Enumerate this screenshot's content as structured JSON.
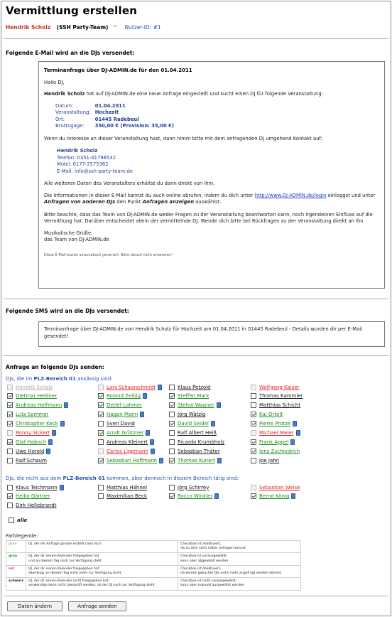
{
  "page": {
    "title": "Vermittlung erstellen",
    "user_name": "Hendrik Scholz",
    "team": "(SSH Party-Team)",
    "caret": "^",
    "user_id": "Nutzer-ID: #1"
  },
  "email": {
    "section_label": "Folgende E-Mail wird an die DJs versendet:",
    "subject": "Terminanfrage über DJ-ADMIN.de für den 01.04.2011",
    "greeting": "Hallo DJ,",
    "intro_name": "Hendrik Scholz",
    "intro_rest": " hat auf DJ-ADMIN.de eine neue Anfrage eingestellt und sucht einen DJ für folgende Veranstaltung:",
    "event": [
      {
        "label": "Datum:",
        "value": "01.04.2011"
      },
      {
        "label": "Veranstaltung:",
        "value": "Hochzeit"
      },
      {
        "label": "Ort:",
        "value": "01445 Radebeul"
      },
      {
        "label": "Bruttogage:",
        "value": "350,00 €   (Provision: 35,00 €)"
      }
    ],
    "interest": "Wenn du Interesse an dieser Veranstaltung hast, dann nimm bitte mit dem anfragenden DJ umgehend Kontakt auf:",
    "contact_name": "Hendrik Scholz",
    "contact_phone": "Telefon:   0351-41798532",
    "contact_mobile": "Mobil:      0177-2575362",
    "contact_email": "E-Mail:     info@ssh-party-team.de",
    "more_data": "Alle weiteren Daten des Veranstalters erhältst du dann direkt von ihm.",
    "online_1": "Die Informationen in dieser E-Mail kannst du auch online abrufen, indem du dich unter ",
    "online_link": "http://www.DJ-ADMIN.de/login",
    "online_2": " einloggst und unter ",
    "online_em1": "Anfragen von anderen DJs",
    "online_3": " den Punkt ",
    "online_em2": "Anfragen anzeigen",
    "online_4": " auswählst.",
    "notice": "Bitte beachte, dass das Team von DJ-ADMIN.de weder Fragen zu der Veranstaltung beantworten kann, noch irgendeinen Einfluss auf die Vermittlung hat. Darüber entscheidet allein der vermittelnde DJ. Wende dich bitte bei Rückfragen zu der Veranstaltung direkt an ihn.",
    "signoff_1": "Musikalische Grüße,",
    "signoff_2": "das Team von DJ-ADMIN.de",
    "footer": "Diese E-Mail wurde automatisch generiert. Bitte darauf nicht antworten!"
  },
  "sms": {
    "section_label": "Folgende SMS wird an die DJs versendet:",
    "text": "Terminanfrage über DJ-ADMIN.de von Hendrik Scholz für Hochzeit am 01.04.2011 in 01445 Radebeul - Details wurden dir per E-Mail gesendet!"
  },
  "request": {
    "section_label": "Anfrage an folgende DJs senden:",
    "group1_pre": "DJs, die im ",
    "group1_bold": "PLZ-Bereich 01",
    "group1_post": " ansässig sind:",
    "group2_pre": "DJs, die nicht aus dem ",
    "group2_bold": "PLZ-Bereich 01",
    "group2_post": " kommen, aber dennoch in diesem Bereich tätig sind:",
    "group1": [
      {
        "name": "Hendrik Scholz",
        "color": "grey",
        "checked": false,
        "disabled": true,
        "icon": false
      },
      {
        "name": "Lars Schaarschmidt",
        "color": "red",
        "checked": false,
        "disabled": true,
        "icon": true
      },
      {
        "name": "Klaus Petzold",
        "color": "black",
        "checked": false,
        "disabled": false,
        "icon": false
      },
      {
        "name": "Wolfgang Kaiser",
        "color": "red",
        "checked": false,
        "disabled": true,
        "icon": false
      },
      {
        "name": "Dietmar Heldner",
        "color": "green",
        "checked": true,
        "disabled": false,
        "icon": false
      },
      {
        "name": "Roland Zeibig",
        "color": "green",
        "checked": true,
        "disabled": false,
        "icon": true
      },
      {
        "name": "Steffen Marx",
        "color": "green",
        "checked": true,
        "disabled": false,
        "icon": false
      },
      {
        "name": "Thomas Kammler",
        "color": "black",
        "checked": false,
        "disabled": false,
        "icon": false
      },
      {
        "name": "Andreas Hoffmann",
        "color": "green",
        "checked": true,
        "disabled": false,
        "icon": true
      },
      {
        "name": "Detlef Lahmer",
        "color": "green",
        "checked": true,
        "disabled": false,
        "icon": false
      },
      {
        "name": "Stefan Wagner",
        "color": "green",
        "checked": true,
        "disabled": false,
        "icon": true
      },
      {
        "name": "Matthias Schicht",
        "color": "black",
        "checked": false,
        "disabled": false,
        "icon": false
      },
      {
        "name": "Lutz Sommer",
        "color": "green",
        "checked": true,
        "disabled": false,
        "icon": false
      },
      {
        "name": "Hagen Mann",
        "color": "green",
        "checked": true,
        "disabled": false,
        "icon": true
      },
      {
        "name": "Jörg Wätzig",
        "color": "black",
        "checked": false,
        "disabled": false,
        "icon": false
      },
      {
        "name": "Kai Ortelt",
        "color": "green",
        "checked": true,
        "disabled": false,
        "icon": false
      },
      {
        "name": "Christopher Keck",
        "color": "green",
        "checked": true,
        "disabled": false,
        "icon": true
      },
      {
        "name": "Sven David",
        "color": "black",
        "checked": false,
        "disabled": false,
        "icon": false
      },
      {
        "name": "David Seidel",
        "color": "green",
        "checked": true,
        "disabled": false,
        "icon": true
      },
      {
        "name": "Pierre Protze",
        "color": "green",
        "checked": true,
        "disabled": false,
        "icon": true
      },
      {
        "name": "Ronny Sickert",
        "color": "red",
        "checked": false,
        "disabled": true,
        "icon": true
      },
      {
        "name": "Arndt Grützner",
        "color": "green",
        "checked": true,
        "disabled": false,
        "icon": true
      },
      {
        "name": "Ralf Albert Heiß",
        "color": "black",
        "checked": false,
        "disabled": false,
        "icon": false
      },
      {
        "name": "Michael Meier",
        "color": "red",
        "checked": false,
        "disabled": true,
        "icon": true
      },
      {
        "name": "Olaf Habnch",
        "color": "green",
        "checked": true,
        "disabled": false,
        "icon": true
      },
      {
        "name": "Andreas Kleinert",
        "color": "black",
        "checked": false,
        "disabled": false,
        "icon": true
      },
      {
        "name": "Ricardo Krumbholz",
        "color": "black",
        "checked": false,
        "disabled": false,
        "icon": false
      },
      {
        "name": "Frank Appel",
        "color": "green",
        "checked": true,
        "disabled": false,
        "icon": true
      },
      {
        "name": "Uwe Horold",
        "color": "black",
        "checked": false,
        "disabled": false,
        "icon": true
      },
      {
        "name": "Carlos Lippmann",
        "color": "red",
        "checked": false,
        "disabled": true,
        "icon": true
      },
      {
        "name": "Sebastian Thäter",
        "color": "black",
        "checked": false,
        "disabled": false,
        "icon": false
      },
      {
        "name": "Jens Zschiedrich",
        "color": "green",
        "checked": true,
        "disabled": false,
        "icon": false
      },
      {
        "name": "Ralf Schaum",
        "color": "black",
        "checked": false,
        "disabled": false,
        "icon": false
      },
      {
        "name": "Sebastian Hoffmann",
        "color": "green",
        "checked": true,
        "disabled": false,
        "icon": true
      },
      {
        "name": "Thomas Kunert",
        "color": "green",
        "checked": true,
        "disabled": false,
        "icon": true
      },
      {
        "name": "Joe Jahn",
        "color": "black",
        "checked": false,
        "disabled": false,
        "icon": false
      }
    ],
    "group2": [
      {
        "name": "Klaus Teichmann",
        "color": "black",
        "checked": false,
        "disabled": false,
        "icon": true
      },
      {
        "name": "Matthias Hähnel",
        "color": "black",
        "checked": false,
        "disabled": false,
        "icon": false
      },
      {
        "name": "Jörg Schirrey",
        "color": "black",
        "checked": false,
        "disabled": false,
        "icon": false
      },
      {
        "name": "Sebastian Weise",
        "color": "red",
        "checked": false,
        "disabled": true,
        "icon": false
      },
      {
        "name": "Heiko Gärtner",
        "color": "green",
        "checked": true,
        "disabled": false,
        "icon": false
      },
      {
        "name": "Maximilian Beck",
        "color": "black",
        "checked": false,
        "disabled": false,
        "icon": false
      },
      {
        "name": "Rocco Winkler",
        "color": "green",
        "checked": true,
        "disabled": false,
        "icon": true
      },
      {
        "name": "Bernd König",
        "color": "green",
        "checked": true,
        "disabled": false,
        "icon": true
      },
      {
        "name": "Dirk Hellebrandt",
        "color": "black",
        "checked": false,
        "disabled": false,
        "icon": false
      }
    ],
    "all_label": "alle"
  },
  "legend": {
    "title": "Farblegende:",
    "rows": [
      {
        "key": "grau",
        "color": "grey",
        "desc": "DJ, der die Anfrage gerade erstellt (also du!)",
        "checkbox": "Checkbox ist deaktiviert,\nda du dich nicht selber anfragen kannst"
      },
      {
        "key": "grün",
        "color": "green",
        "desc": "DJ, der dir seinen Kalender freigegeben hat\nund an diesem Tag noch zur Verfügung steht",
        "checkbox": "Checkbox ist vorausgewählt,\nkann aber abgewählt werden"
      },
      {
        "key": "rot",
        "color": "red",
        "desc": "DJ, der dir seinen Kalender freigegeben hat\nallerdings an diesem Tag nicht mehr zur Verfügung steht",
        "checkbox": "Checkbox ist deaktiviert,\nda bereits gebuchte DJs nicht mehr angefragt werden können"
      },
      {
        "key": "schwarz",
        "color": "black",
        "desc": "DJ, der dir seinen Kalender nicht freigegeben hat -\nverwendige kann nicht überprüft werden, ob der DJ noch zur Verfügung steht",
        "checkbox": "Checkbox ist nicht vorausgewählt,\nkann aber manuell ausgewählt werden"
      }
    ]
  },
  "buttons": {
    "change": "Daten ändern",
    "send": "Anfrage senden"
  }
}
